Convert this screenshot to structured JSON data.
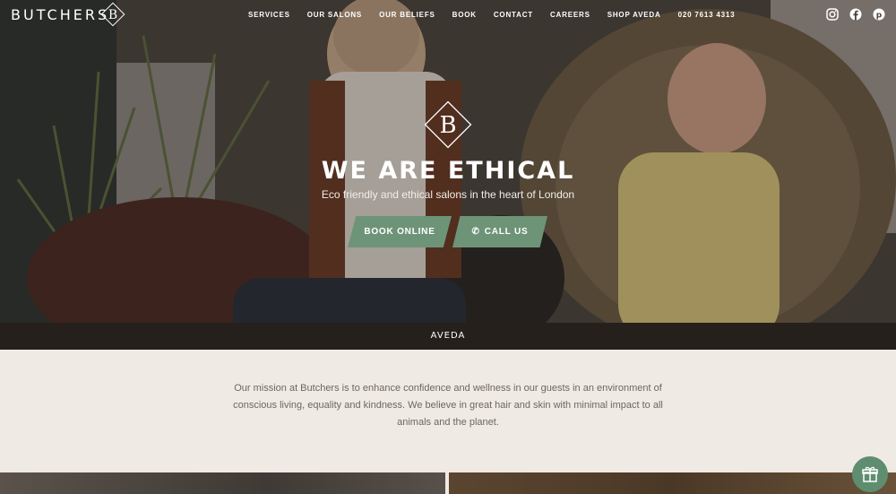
{
  "nav": {
    "logo": "BUTCHERS",
    "items": [
      "SERVICES",
      "OUR SALONS",
      "OUR BELIEFS",
      "BOOK",
      "CONTACT",
      "CAREERS",
      "SHOP AVEDA",
      "020 7613 4313"
    ],
    "social_icons": [
      "instagram-icon",
      "facebook-icon",
      "pinterest-icon"
    ]
  },
  "hero": {
    "title": "WE ARE ETHICAL",
    "subtitle": "Eco friendly and ethical salons in the heart of London",
    "book_label": "BOOK ONLINE",
    "call_label": "CALL US",
    "brand": "AVEDA"
  },
  "mission": {
    "text": "Our mission at Butchers is to enhance confidence and wellness in our guests in an environment of conscious living, equality and kindness. We believe in great hair and skin with minimal impact to all animals and the planet."
  },
  "colors": {
    "accent": "#6e9478",
    "mission_bg": "#efebe4",
    "text_muted": "#6d6660"
  }
}
